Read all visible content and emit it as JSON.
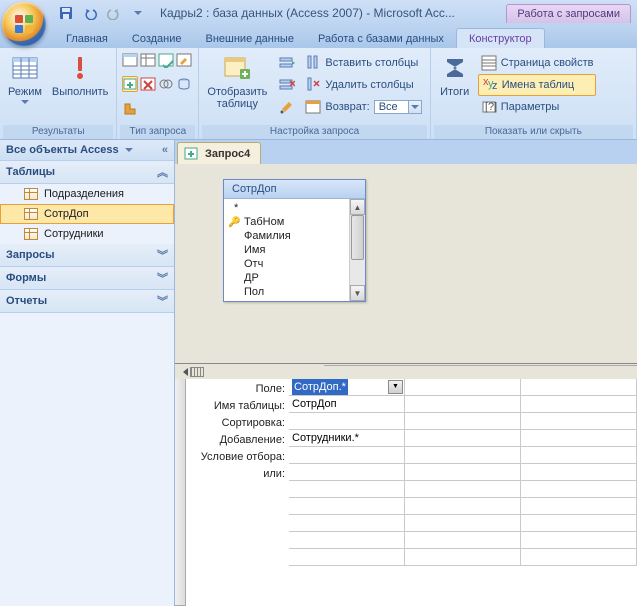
{
  "title": "Кадры2 : база данных (Access 2007) - Microsoft Acc...",
  "contextTabGroup": "Работа с запросами",
  "tabs": [
    "Главная",
    "Создание",
    "Внешние данные",
    "Работа с базами данных",
    "Конструктор"
  ],
  "ribbon": {
    "g1": {
      "label": "Результаты",
      "mode": "Режим",
      "run": "Выполнить"
    },
    "g2": {
      "label": "Тип запроса"
    },
    "g3": {
      "label": "Настройка запроса",
      "show": "Отобразить\nтаблицу",
      "insert": "Вставить столбцы",
      "delete": "Удалить столбцы",
      "return": "Возврат:",
      "returnVal": "Все"
    },
    "g4": {
      "label": "Показать или скрыть",
      "totals": "Итоги",
      "props": "Страница свойств",
      "names": "Имена таблиц",
      "params": "Параметры"
    }
  },
  "nav": {
    "header": "Все объекты Access",
    "cats": {
      "tables": "Таблицы",
      "queries": "Запросы",
      "forms": "Формы",
      "reports": "Отчеты"
    },
    "tables": [
      "Подразделения",
      "СотрДоп",
      "Сотрудники"
    ]
  },
  "docTab": "Запрос4",
  "card": {
    "title": "СотрДоп",
    "fields": [
      "*",
      "ТабНом",
      "Фамилия",
      "Имя",
      "Отч",
      "ДР",
      "Пол"
    ]
  },
  "grid": {
    "labels": [
      "Поле:",
      "Имя таблицы:",
      "Сортировка:",
      "Добавление:",
      "Условие отбора:",
      "или:"
    ],
    "col1": {
      "field": "СотрДоп.*",
      "table": "СотрДоп",
      "append": "Сотрудники.*"
    }
  }
}
